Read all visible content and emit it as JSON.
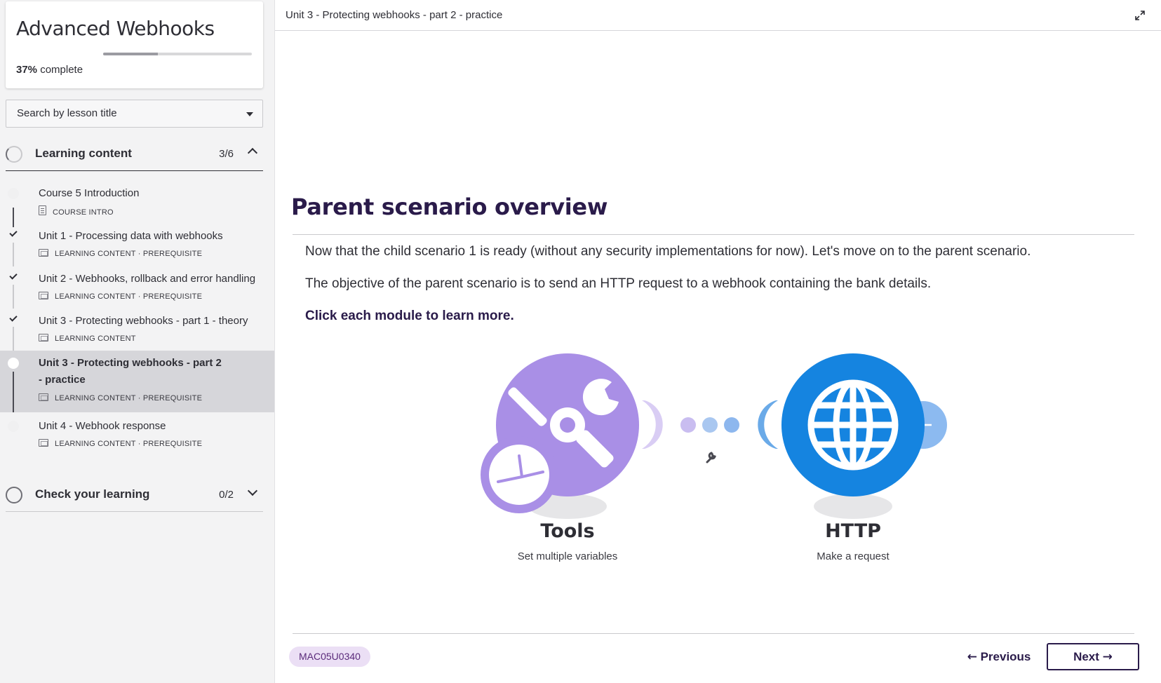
{
  "sidebar": {
    "course_title": "Advanced Webhooks",
    "progress_value": "37%",
    "progress_suffix": " complete",
    "progress_fraction": 0.37,
    "search_placeholder": "Search by lesson title",
    "sections": [
      {
        "title": "Learning content",
        "count": "3/6",
        "expanded": true
      },
      {
        "title": "Check your learning",
        "count": "0/2",
        "expanded": false
      }
    ],
    "lessons": [
      {
        "title": "Course 5 Introduction",
        "meta": "COURSE INTRO",
        "status": "not-started",
        "icon": "document-icon"
      },
      {
        "title": "Unit 1 - Processing data with webhooks",
        "meta": "LEARNING CONTENT · PREREQUISITE",
        "status": "completed",
        "icon": "slides-icon"
      },
      {
        "title": "Unit 2 - Webhooks, rollback and error handling",
        "meta": "LEARNING CONTENT · PREREQUISITE",
        "status": "completed",
        "icon": "slides-icon"
      },
      {
        "title": "Unit 3 - Protecting webhooks - part 1 - theory",
        "meta": "LEARNING CONTENT",
        "status": "completed",
        "icon": "slides-icon"
      },
      {
        "title": "Unit 3 - Protecting webhooks - part 2 - practice",
        "meta": "LEARNING CONTENT · PREREQUISITE",
        "status": "current",
        "icon": "slides-icon"
      },
      {
        "title": "Unit 4 - Webhook response",
        "meta": "LEARNING CONTENT · PREREQUISITE",
        "status": "not-started",
        "icon": "slides-icon"
      }
    ]
  },
  "main": {
    "breadcrumb": "Unit 3 - Protecting webhooks - part 2 - practice",
    "heading": "Parent scenario overview",
    "paragraphs": [
      "Now that the child scenario 1 is ready (without any security implementations for now). Let's move on to the parent scenario.",
      "The objective of the parent scenario is to send an HTTP request to a webhook containing the bank details.",
      "Click each module to learn more."
    ],
    "modules": [
      {
        "name": "Tools",
        "subtitle": "Set multiple variables",
        "color": "#a98fe6"
      },
      {
        "name": "HTTP",
        "subtitle": "Make a request",
        "color": "#1584e0"
      }
    ],
    "code": "MAC05U0340",
    "previous_label": "Previous",
    "next_label": "Next",
    "colors": {
      "heading": "#2a1b4a",
      "badge_bg": "#ebdff5",
      "badge_text": "#5a2a7a"
    }
  }
}
